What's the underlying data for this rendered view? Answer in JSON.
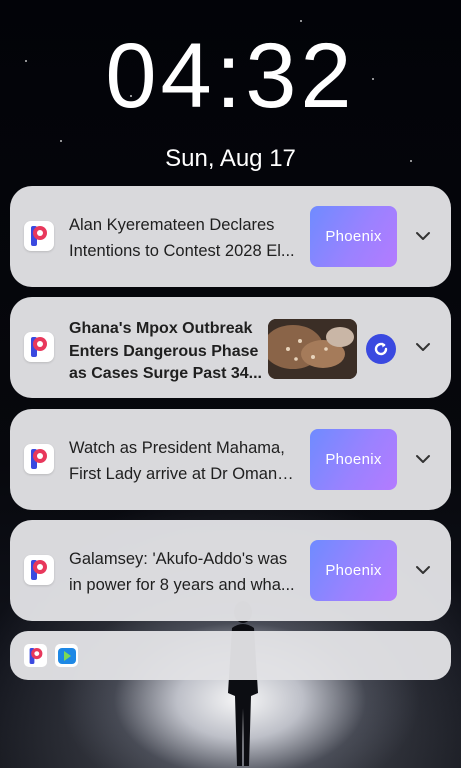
{
  "lockscreen": {
    "time": "04:32",
    "date": "Sun, Aug 17"
  },
  "notifications": [
    {
      "app": "Phoenix",
      "line1": "Alan Kyeremateen Declares",
      "line2": "Intentions to Contest 2028 El...",
      "thumb_label": "Phoenix"
    },
    {
      "app": "Phoenix",
      "line1": "Ghana's Mpox Outbreak",
      "line2": "Enters Dangerous Phase",
      "line3": "as Cases Surge Past 34..."
    },
    {
      "app": "Phoenix",
      "line1": "Watch as President Mahama,",
      "line2": "First Lady arrive at Dr Omane...",
      "thumb_label": "Phoenix"
    },
    {
      "app": "Phoenix",
      "line1": "Galamsey: 'Akufo-Addo's was",
      "line2": "in power for 8 years and wha...",
      "thumb_label": "Phoenix"
    }
  ],
  "icons": {
    "app_icon": "phoenix-p-logo-icon",
    "expand": "chevron-down-icon",
    "refresh": "refresh-icon",
    "stack_icons": [
      "phoenix-p-logo-icon",
      "play-store-app-icon"
    ]
  },
  "colors": {
    "card_bg": "#e2e2e5",
    "brand_gradient_start": "#6f8bff",
    "brand_gradient_end": "#b47bff",
    "refresh_blue": "#3a49e0",
    "logo_blue": "#3a49e0",
    "logo_pink": "#e8385c"
  }
}
